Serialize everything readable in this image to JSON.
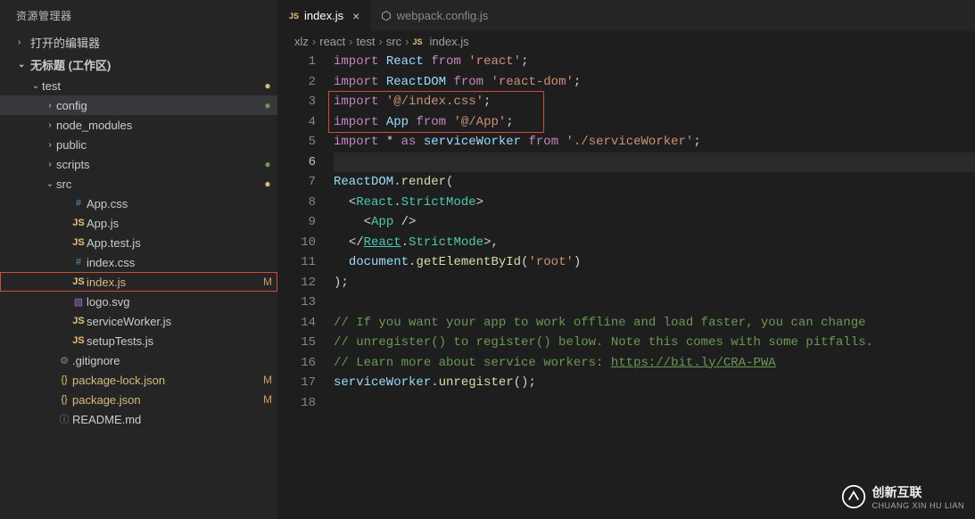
{
  "explorer": {
    "title": "资源管理器",
    "opened_editors_label": "打开的编辑器",
    "workspace_label": "无标题 (工作区)"
  },
  "tree": [
    {
      "type": "folder",
      "label": "test",
      "indent": 1,
      "open": true,
      "status": "dot-yel"
    },
    {
      "type": "folder",
      "label": "config",
      "indent": 2,
      "open": false,
      "selected": true,
      "status": "dot-grn"
    },
    {
      "type": "folder",
      "label": "node_modules",
      "indent": 2,
      "open": false,
      "dim": true
    },
    {
      "type": "folder",
      "label": "public",
      "indent": 2,
      "open": false
    },
    {
      "type": "folder",
      "label": "scripts",
      "indent": 2,
      "open": false,
      "status": "dot-grn"
    },
    {
      "type": "folder",
      "label": "src",
      "indent": 2,
      "open": true,
      "status": "dot-yel"
    },
    {
      "type": "file",
      "label": "App.css",
      "indent": 3,
      "icon": "hash"
    },
    {
      "type": "file",
      "label": "App.js",
      "indent": 3,
      "icon": "js"
    },
    {
      "type": "file",
      "label": "App.test.js",
      "indent": 3,
      "icon": "js"
    },
    {
      "type": "file",
      "label": "index.css",
      "indent": 3,
      "icon": "hash"
    },
    {
      "type": "file",
      "label": "index.js",
      "indent": 3,
      "icon": "js",
      "highlighted": true,
      "status": "M",
      "modified": true
    },
    {
      "type": "file",
      "label": "logo.svg",
      "indent": 3,
      "icon": "svg"
    },
    {
      "type": "file",
      "label": "serviceWorker.js",
      "indent": 3,
      "icon": "js"
    },
    {
      "type": "file",
      "label": "setupTests.js",
      "indent": 3,
      "icon": "js"
    },
    {
      "type": "file",
      "label": ".gitignore",
      "indent": 2,
      "icon": "gear",
      "dim": true
    },
    {
      "type": "file",
      "label": "package-lock.json",
      "indent": 2,
      "icon": "curly",
      "status": "M",
      "modified": true
    },
    {
      "type": "file",
      "label": "package.json",
      "indent": 2,
      "icon": "curly",
      "status": "M",
      "modified": true
    },
    {
      "type": "file",
      "label": "README.md",
      "indent": 2,
      "icon": "readme"
    }
  ],
  "tabs": [
    {
      "label": "index.js",
      "icon": "js",
      "active": true
    },
    {
      "label": "webpack.config.js",
      "icon": "webpack",
      "active": false
    }
  ],
  "breadcrumb": [
    "xlz",
    "react",
    "test",
    "src",
    "index.js"
  ],
  "breadcrumb_file_icon": "JS",
  "code": {
    "line_count": 18,
    "cursor_line": 6,
    "highlight_box": {
      "top_line": 3,
      "bottom_line": 4
    },
    "lines": [
      {
        "t": [
          [
            "kw",
            "import"
          ],
          [
            " "
          ],
          [
            "var",
            "React"
          ],
          [
            " "
          ],
          [
            "kw",
            "from"
          ],
          [
            " "
          ],
          [
            "str",
            "'react'"
          ],
          [
            "pun",
            ";"
          ]
        ]
      },
      {
        "t": [
          [
            "kw",
            "import"
          ],
          [
            " "
          ],
          [
            "var",
            "ReactDOM"
          ],
          [
            " "
          ],
          [
            "kw",
            "from"
          ],
          [
            " "
          ],
          [
            "str",
            "'react-dom'"
          ],
          [
            "pun",
            ";"
          ]
        ]
      },
      {
        "t": [
          [
            "kw",
            "import"
          ],
          [
            " "
          ],
          [
            "str",
            "'@/index.css'"
          ],
          [
            "pun",
            ";"
          ]
        ]
      },
      {
        "t": [
          [
            "kw",
            "import"
          ],
          [
            " "
          ],
          [
            "var",
            "App"
          ],
          [
            " "
          ],
          [
            "kw",
            "from"
          ],
          [
            " "
          ],
          [
            "str",
            "'@/App'"
          ],
          [
            "pun",
            ";"
          ]
        ]
      },
      {
        "t": [
          [
            "kw",
            "import"
          ],
          [
            " "
          ],
          [
            "pun",
            "*"
          ],
          [
            " "
          ],
          [
            "kw",
            "as"
          ],
          [
            " "
          ],
          [
            "var",
            "serviceWorker"
          ],
          [
            " "
          ],
          [
            "kw",
            "from"
          ],
          [
            " "
          ],
          [
            "str",
            "'./serviceWorker'"
          ],
          [
            "pun",
            ";"
          ]
        ]
      },
      {
        "t": []
      },
      {
        "t": [
          [
            "var",
            "ReactDOM"
          ],
          [
            "pun",
            "."
          ],
          [
            "fn",
            "render"
          ],
          [
            "pun",
            "("
          ]
        ]
      },
      {
        "t": [
          [
            "",
            "  "
          ],
          [
            "pun",
            "<"
          ],
          [
            "cls",
            "React"
          ],
          [
            "pun",
            "."
          ],
          [
            "cls",
            "StrictMode"
          ],
          [
            "pun",
            ">"
          ]
        ]
      },
      {
        "t": [
          [
            "",
            "    "
          ],
          [
            "pun",
            "<"
          ],
          [
            "cls",
            "App"
          ],
          [
            "pun",
            " />"
          ]
        ]
      },
      {
        "t": [
          [
            "",
            "  "
          ],
          [
            "pun",
            "</"
          ],
          [
            "cls link",
            "React"
          ],
          [
            "pun",
            "."
          ],
          [
            "cls",
            "StrictMode"
          ],
          [
            "pun",
            ">,"
          ]
        ]
      },
      {
        "t": [
          [
            "",
            "  "
          ],
          [
            "var",
            "document"
          ],
          [
            "pun",
            "."
          ],
          [
            "fn",
            "getElementById"
          ],
          [
            "pun",
            "("
          ],
          [
            "str",
            "'root'"
          ],
          [
            "pun",
            ")"
          ]
        ]
      },
      {
        "t": [
          [
            "pun",
            ");"
          ]
        ]
      },
      {
        "t": []
      },
      {
        "t": [
          [
            "cmt",
            "// If you want your app to work offline and load faster, you can change"
          ]
        ]
      },
      {
        "t": [
          [
            "cmt",
            "// unregister() to register() below. Note this comes with some pitfalls."
          ]
        ]
      },
      {
        "t": [
          [
            "cmt",
            "// Learn more about service workers: "
          ],
          [
            "cmt link",
            "https://bit.ly/CRA-PWA"
          ]
        ]
      },
      {
        "t": [
          [
            "var",
            "serviceWorker"
          ],
          [
            "pun",
            "."
          ],
          [
            "fn",
            "unregister"
          ],
          [
            "pun",
            "();"
          ]
        ]
      },
      {
        "t": []
      }
    ]
  },
  "watermark": {
    "cn": "创新互联",
    "en": "CHUANG XIN HU LIAN"
  }
}
